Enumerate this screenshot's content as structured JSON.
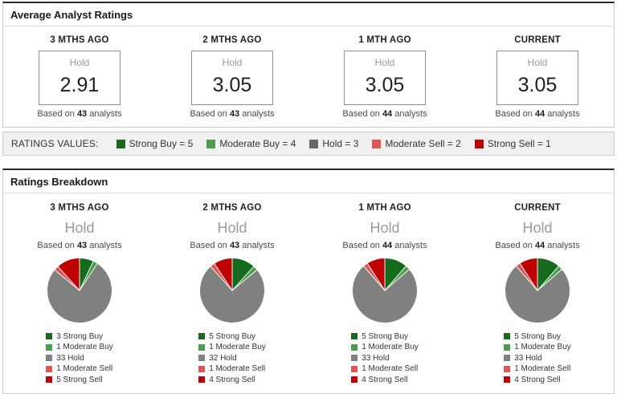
{
  "panels": {
    "avg": {
      "title": "Average Analyst Ratings",
      "columns": [
        {
          "label": "3 MTHS AGO",
          "rating": "Hold",
          "value": "2.91",
          "based_prefix": "Based on",
          "count": "43",
          "based_suffix": "analysts"
        },
        {
          "label": "2 MTHS AGO",
          "rating": "Hold",
          "value": "3.05",
          "based_prefix": "Based on",
          "count": "43",
          "based_suffix": "analysts"
        },
        {
          "label": "1 MTH AGO",
          "rating": "Hold",
          "value": "3.05",
          "based_prefix": "Based on",
          "count": "44",
          "based_suffix": "analysts"
        },
        {
          "label": "CURRENT",
          "rating": "Hold",
          "value": "3.05",
          "based_prefix": "Based on",
          "count": "44",
          "based_suffix": "analysts"
        }
      ]
    },
    "legend_row": {
      "label": "RATINGS VALUES:",
      "items": [
        {
          "label": "Strong Buy = 5",
          "color": "#166a1e"
        },
        {
          "label": "Moderate Buy = 4",
          "color": "#4c9e4c"
        },
        {
          "label": "Hold = 3",
          "color": "#666666"
        },
        {
          "label": "Moderate Sell = 2",
          "color": "#e05656"
        },
        {
          "label": "Strong Sell = 1",
          "color": "#c00000"
        }
      ]
    },
    "breakdown": {
      "title": "Ratings Breakdown"
    }
  },
  "chart_data": [
    {
      "type": "pie",
      "title": "3 MTHS AGO",
      "rating": "Hold",
      "based_prefix": "Based on",
      "count": "43",
      "based_suffix": "analysts",
      "labels": [
        "Strong Buy",
        "Moderate Buy",
        "Hold",
        "Moderate Sell",
        "Strong Sell"
      ],
      "values": [
        3,
        1,
        33,
        1,
        5
      ],
      "colors": [
        "#166a1e",
        "#4c9e4c",
        "#808080",
        "#e05656",
        "#c00000"
      ]
    },
    {
      "type": "pie",
      "title": "2 MTHS AGO",
      "rating": "Hold",
      "based_prefix": "Based on",
      "count": "43",
      "based_suffix": "analysts",
      "labels": [
        "Strong Buy",
        "Moderate Buy",
        "Hold",
        "Moderate Sell",
        "Strong Sell"
      ],
      "values": [
        5,
        1,
        32,
        1,
        4
      ],
      "colors": [
        "#166a1e",
        "#4c9e4c",
        "#808080",
        "#e05656",
        "#c00000"
      ]
    },
    {
      "type": "pie",
      "title": "1 MTH AGO",
      "rating": "Hold",
      "based_prefix": "Based on",
      "count": "44",
      "based_suffix": "analysts",
      "labels": [
        "Strong Buy",
        "Moderate Buy",
        "Hold",
        "Moderate Sell",
        "Strong Sell"
      ],
      "values": [
        5,
        1,
        33,
        1,
        4
      ],
      "colors": [
        "#166a1e",
        "#4c9e4c",
        "#808080",
        "#e05656",
        "#c00000"
      ]
    },
    {
      "type": "pie",
      "title": "CURRENT",
      "rating": "Hold",
      "based_prefix": "Based on",
      "count": "44",
      "based_suffix": "analysts",
      "labels": [
        "Strong Buy",
        "Moderate Buy",
        "Hold",
        "Moderate Sell",
        "Strong Sell"
      ],
      "values": [
        5,
        1,
        33,
        1,
        4
      ],
      "colors": [
        "#166a1e",
        "#4c9e4c",
        "#808080",
        "#e05656",
        "#c00000"
      ]
    }
  ]
}
